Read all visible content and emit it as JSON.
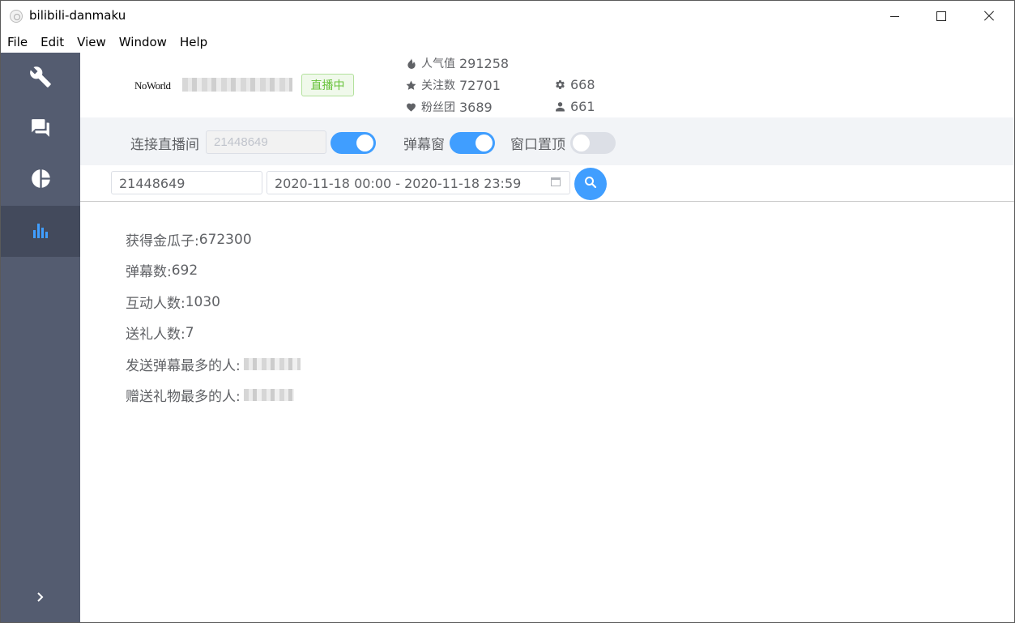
{
  "window": {
    "title": "bilibili-danmaku"
  },
  "menu": [
    "File",
    "Edit",
    "View",
    "Window",
    "Help"
  ],
  "sidebar": {
    "items": [
      {
        "icon": "wrench-icon"
      },
      {
        "icon": "chat-icon"
      },
      {
        "icon": "pie-chart-icon"
      },
      {
        "icon": "bar-chart-icon",
        "active": true
      }
    ],
    "expand_icon": "chevron-right-icon"
  },
  "header": {
    "logo_text": "NoWorld",
    "live_status": "直播中",
    "stats": {
      "popularity_label": "人气值",
      "popularity": "291258",
      "followers_label": "关注数",
      "followers": "72701",
      "fan_club_label": "粉丝团",
      "fan_club": "3689",
      "gear_value": "668",
      "user_value": "661"
    }
  },
  "toolbar": {
    "connect_label": "连接直播间",
    "room_id": "21448649",
    "connect_on": true,
    "danmaku_window_label": "弹幕窗",
    "danmaku_window_on": true,
    "always_on_top_label": "窗口置顶",
    "always_on_top_on": false
  },
  "query": {
    "room_id": "21448649",
    "date_range": "2020-11-18 00:00 - 2020-11-18 23:59"
  },
  "results": {
    "gold_label": "获得金瓜子: ",
    "gold": "672300",
    "danmaku_label": "弹幕数: ",
    "danmaku": "692",
    "interact_label": "互动人数: ",
    "interact": "1030",
    "gift_users_label": "送礼人数: ",
    "gift_users": "7",
    "top_danmaku_label": "发送弹幕最多的人: ",
    "top_gift_label": "赠送礼物最多的人: "
  },
  "colors": {
    "accent": "#409eff",
    "sidebar": "#545c70",
    "sidebar_active": "#434a5c",
    "live_green": "#67c23a"
  }
}
